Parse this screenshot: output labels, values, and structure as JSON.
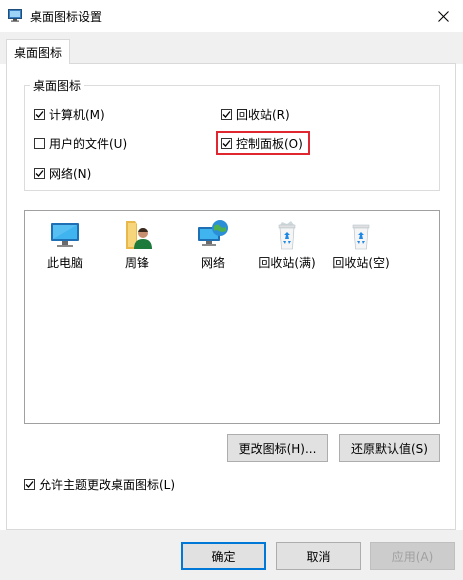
{
  "window": {
    "title": "桌面图标设置"
  },
  "tabs": [
    {
      "label": "桌面图标"
    }
  ],
  "group": {
    "legend": "桌面图标",
    "checkboxes": [
      {
        "label": "计算机(M)",
        "checked": true
      },
      {
        "label": "回收站(R)",
        "checked": true
      },
      {
        "label": "用户的文件(U)",
        "checked": false
      },
      {
        "label": "控制面板(O)",
        "checked": true
      },
      {
        "label": "网络(N)",
        "checked": true
      }
    ]
  },
  "icons": [
    {
      "label": "此电脑",
      "icon": "computer-icon"
    },
    {
      "label": "周锋",
      "icon": "user-folder-icon"
    },
    {
      "label": "网络",
      "icon": "network-icon"
    },
    {
      "label": "回收站(满)",
      "icon": "recycle-bin-full-icon"
    },
    {
      "label": "回收站(空)",
      "icon": "recycle-bin-empty-icon"
    }
  ],
  "buttons": {
    "change_icon": "更改图标(H)...",
    "restore_default": "还原默认值(S)"
  },
  "allow_themes": {
    "label": "允许主题更改桌面图标(L)",
    "checked": true
  },
  "footer": {
    "ok": "确定",
    "cancel": "取消",
    "apply": "应用(A)"
  },
  "colors": {
    "highlight": "#e0262e",
    "primary_border": "#0078d7",
    "dialog_bg": "#f0f0f0"
  }
}
